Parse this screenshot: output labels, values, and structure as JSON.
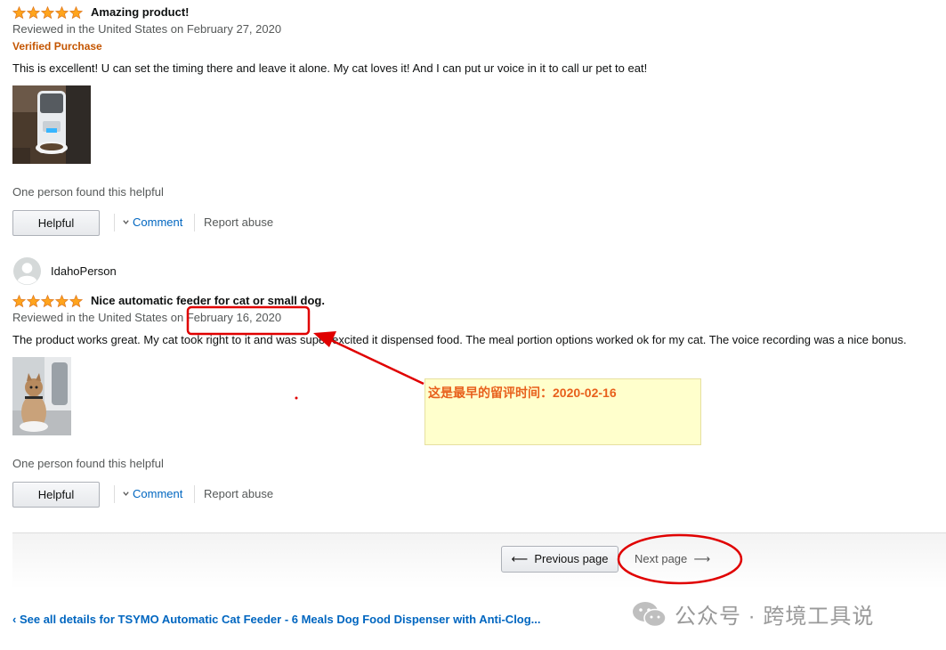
{
  "reviews": [
    {
      "rating": 5,
      "title": "Amazing product!",
      "meta": "Reviewed in the United States on February 27, 2020",
      "verified": "Verified Purchase",
      "body": "This is excellent! U can set the timing there and leave it alone. My cat loves it! And I can put ur voice in it to call ur pet to eat!",
      "helpful_count": "One person found this helpful",
      "helpful_label": "Helpful",
      "comment_label": "Comment",
      "report_label": "Report abuse"
    },
    {
      "reviewer": "IdahoPerson",
      "rating": 5,
      "title": "Nice automatic feeder for cat or small dog.",
      "meta_prefix": "Reviewed in the United States on",
      "meta_date": "February 16, 2020",
      "body": "The product works great. My cat took right to it and was super excited it dispensed food. The meal portion options worked ok for my cat. The voice recording was a nice bonus.",
      "helpful_count": "One person found this helpful",
      "helpful_label": "Helpful",
      "comment_label": "Comment",
      "report_label": "Report abuse"
    }
  ],
  "pagination": {
    "previous_label": "Previous page",
    "next_label": "Next page"
  },
  "see_all_link": "See all details for TSYMO Automatic Cat Feeder - 6 Meals Dog Food Dispenser with Anti-Clog...",
  "annotation": {
    "text": "这是最早的留评时间：2020-02-16",
    "highlight_color": "#e00000"
  },
  "watermark": {
    "text": "公众号 · 跨境工具说"
  },
  "colors": {
    "star": "#ffa41c",
    "link": "#0066c0",
    "verified": "#c45500",
    "annotation_red": "#e00000"
  }
}
